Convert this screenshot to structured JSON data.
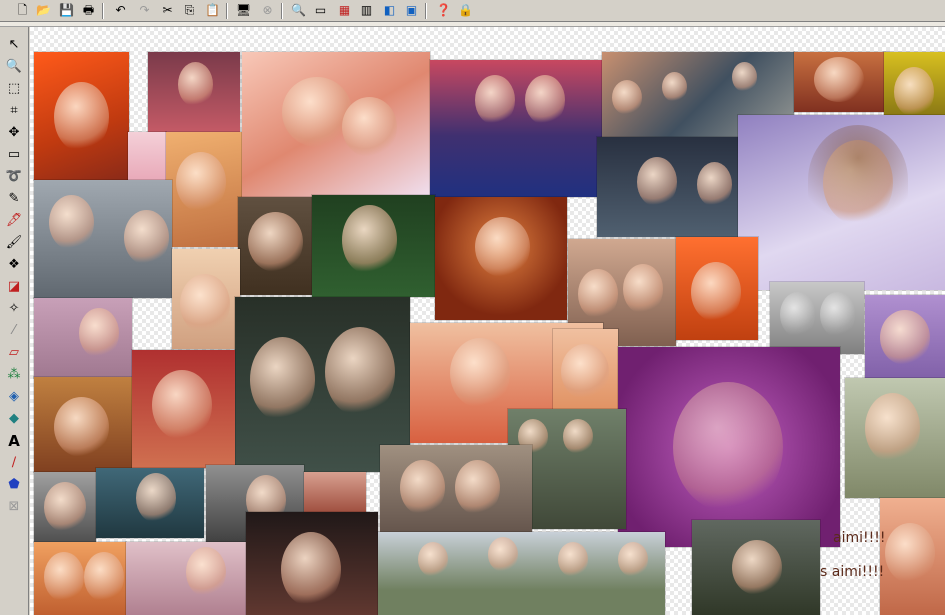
{
  "toolbar": {
    "icons": [
      {
        "name": "new-file-icon",
        "glyph": "🗋"
      },
      {
        "name": "open-folder-icon",
        "glyph": "📂"
      },
      {
        "name": "save-icon",
        "glyph": "💾"
      },
      {
        "name": "print-icon",
        "glyph": "🖶"
      },
      {
        "name": "undo-icon",
        "glyph": "↶"
      },
      {
        "name": "redo-icon",
        "glyph": "↷"
      },
      {
        "name": "cut-icon",
        "glyph": "✂"
      },
      {
        "name": "copy-icon",
        "glyph": "⎘"
      },
      {
        "name": "paste-icon",
        "glyph": "📋"
      },
      {
        "name": "screen-capture-icon",
        "glyph": "🖥"
      },
      {
        "name": "disabled-tool-icon",
        "glyph": "⊗"
      },
      {
        "name": "zoom-icon",
        "glyph": "🔍"
      },
      {
        "name": "image-size-icon",
        "glyph": "▭"
      },
      {
        "name": "color-palette-icon",
        "glyph": "▦"
      },
      {
        "name": "histogram-icon",
        "glyph": "▥"
      },
      {
        "name": "layers-icon",
        "glyph": "◧"
      },
      {
        "name": "window-icon",
        "glyph": "▣"
      },
      {
        "name": "help-pointer-icon",
        "glyph": "❓"
      },
      {
        "name": "lock-icon",
        "glyph": "🔒"
      }
    ]
  },
  "tools": [
    {
      "name": "arrow-select-icon",
      "glyph": "↖"
    },
    {
      "name": "zoom-tool-icon",
      "glyph": "🔍"
    },
    {
      "name": "marquee-select-icon",
      "glyph": "⬚"
    },
    {
      "name": "crop-icon",
      "glyph": "⌗"
    },
    {
      "name": "move-icon",
      "glyph": "✥"
    },
    {
      "name": "rectangle-select-icon",
      "glyph": "▭"
    },
    {
      "name": "lasso-icon",
      "glyph": "➰"
    },
    {
      "name": "pencil-icon",
      "glyph": "✎"
    },
    {
      "name": "dropper-icon",
      "glyph": "🖋"
    },
    {
      "name": "brush-icon",
      "glyph": "🖌"
    },
    {
      "name": "clone-icon",
      "glyph": "❖"
    },
    {
      "name": "color-replace-icon",
      "glyph": "◪"
    },
    {
      "name": "retouch-icon",
      "glyph": "✧"
    },
    {
      "name": "smudge-icon",
      "glyph": "⁄"
    },
    {
      "name": "eraser-icon",
      "glyph": "▱"
    },
    {
      "name": "spray-icon",
      "glyph": "⁂"
    },
    {
      "name": "fill-icon",
      "glyph": "◈"
    },
    {
      "name": "diamond-icon",
      "glyph": "◆"
    },
    {
      "name": "text-icon",
      "glyph": "A"
    },
    {
      "name": "line-icon",
      "glyph": "∕"
    },
    {
      "name": "shapes-icon",
      "glyph": "⬟"
    },
    {
      "name": "transparency-icon",
      "glyph": "⊠"
    }
  ],
  "captions": {
    "line1": "aimi!!!!",
    "line2": "s aimi!!!!"
  },
  "colors": {
    "toolbar_bg": "#d4d0c8",
    "canvas_check": "#e8e8e8"
  }
}
